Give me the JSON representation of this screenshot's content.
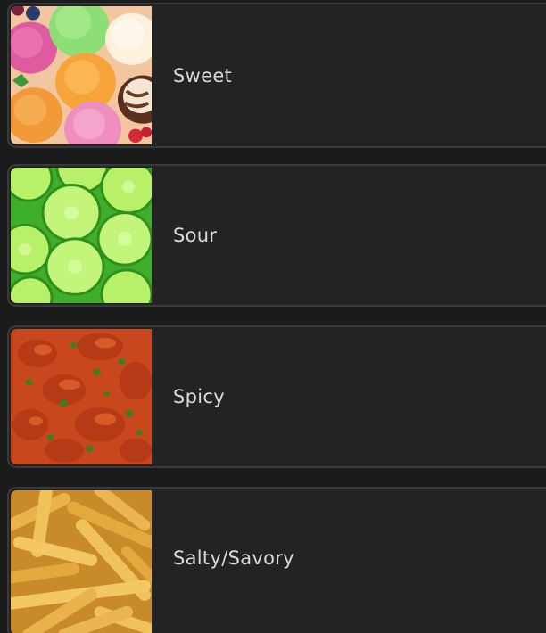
{
  "flavors": [
    {
      "label": "Sweet",
      "image": "ice-cream-scoops"
    },
    {
      "label": "Sour",
      "image": "lime-slices"
    },
    {
      "label": "Spicy",
      "image": "curry-with-herbs"
    },
    {
      "label": "Salty/Savory",
      "image": "french-fries"
    }
  ]
}
